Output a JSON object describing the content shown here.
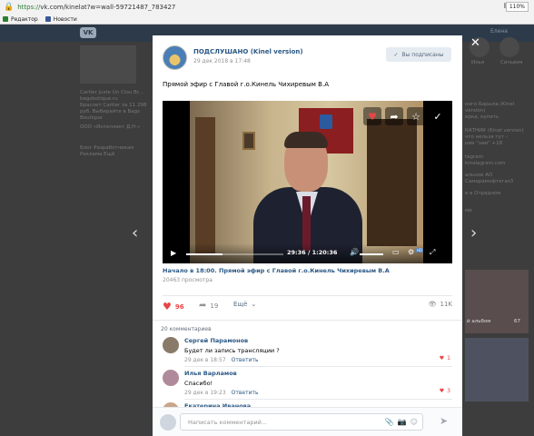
{
  "browser": {
    "url_prefix": "https://",
    "url_rest": "vk.com/kinelat?w=wall-59721487_783427",
    "zoom": "110%",
    "bookmarks": [
      {
        "label": "Редактор",
        "color": "#2e7d32"
      },
      {
        "label": "Новости",
        "color": "#3b5998"
      }
    ]
  },
  "background": {
    "user_short": "Елена",
    "left_texts": [
      "Cartier Juste Un Clou Br...",
      "bagsbotique.ru",
      "Браслет Cartier за 11 298",
      "руб. Выбирайте в Bags",
      "Boutique",
      "ООО «Интеллект Д.Н.»",
      "Блог    Разработчикам",
      "Реклама    Ещё"
    ],
    "right_texts": [
      "Илья",
      "Сильвия",
      "ного Барыла (Kinel",
      "version)",
      "ерка, купить",
      "КАТНИК (Kinel version)",
      "что нельзя тут -",
      "ние \"зам\" +18",
      "tagram",
      "kinelagram.com",
      "альное АО",
      "Самарамнфтегаз3",
      "е в Отрадном",
      "ми",
      "й альбом",
      "67"
    ]
  },
  "post": {
    "group_name": "ПОДСЛУШАНО (Kinel version)",
    "date": "29 дек 2018 в 17:48",
    "subscribed_label": "Вы подписаны",
    "text": "Прямой эфир с Главой г.о.Кинель Чихиревым В.А",
    "video": {
      "time": "29:36",
      "duration": "1:20:36",
      "progress_fraction": 0.37,
      "hd_badge": "HD",
      "title": "Начало в 18:00. Прямой эфир с Главой г.о.Кинель Чихиревым В.А",
      "views": "20463 просмотра"
    },
    "likes": "96",
    "shares": "19",
    "more_label": "Ещё",
    "views_short": "11K",
    "comments_header": "20 комментариев",
    "comments": [
      {
        "author": "Сергей Парамонов",
        "text": "Будет ли запись трансляции ?",
        "date": "29 дек в 18:57",
        "reply": "Ответить",
        "likes": "1",
        "avatar_color": "#8a7a6a"
      },
      {
        "author": "Илья Варламов",
        "text": "Спасибо!",
        "date": "29 дек в 19:23",
        "reply": "Ответить",
        "likes": "3",
        "avatar_color": "#b08a9a"
      },
      {
        "author": "Екатерина Иванова",
        "text": "",
        "date": "",
        "reply": "",
        "likes": "",
        "avatar_color": "#c9a58a"
      }
    ],
    "composer_placeholder": "Написать комментарий..."
  },
  "colors": {
    "accent": "#2a5885",
    "like": "#e64646"
  }
}
